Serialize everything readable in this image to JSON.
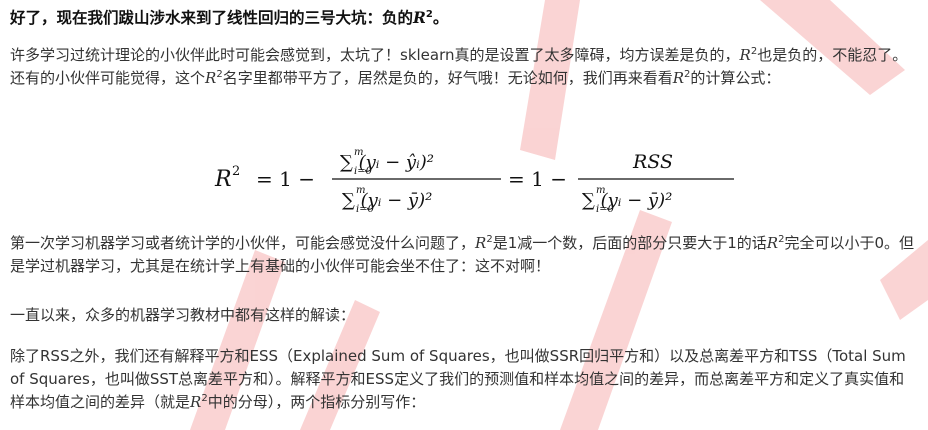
{
  "heading": {
    "text": "好了，现在我们跋山涉水来到了线性回归的三号大坑：负的",
    "symbol": "R",
    "sup": "2",
    "end": "。"
  },
  "p1": {
    "a": "许多学习过统计理论的小伙伴此时可能会感觉到，太坑了！sklearn真的是设置了太多障碍，均方误差是负的，",
    "r1": "R",
    "s1": "2",
    "b": "也",
    "c": "是负的，不能忍了。还有的小伙伴可能觉得，这个",
    "r2": "R",
    "s2": "2",
    "d": "名字里都带平方了，居然是负的，好气哦！无论如何，我们再",
    "e": "来看看",
    "r3": "R",
    "s3": "2",
    "f": "的计算公式："
  },
  "formula": {
    "lhs": "R",
    "lhs_sup": "2",
    "eq1": "= 1 −",
    "num1": "∑ (yᵢ − ŷᵢ)²",
    "den1": "∑ (yᵢ − ȳ)²",
    "sum_top": "m",
    "sum_bottom": "i=0",
    "eq2": "= 1 −",
    "num2": "RSS",
    "den2": "∑ (yᵢ − ȳ)²"
  },
  "p2": {
    "a": "第一次学习机器学习或者统计学的小伙伴，可能会感觉没什么问题了，",
    "r1": "R",
    "s1": "2",
    "b": "是1减一个数，后面的部分只要大于1的话",
    "r2": "R",
    "s2": "2",
    "c": "完全可以小于0。但是学过机器学习，尤其是在统计学上有基础的小伙伴可能会坐不住了：这不对啊！"
  },
  "p3": {
    "text": "一直以来，众多的机器学习教材中都有这样的解读："
  },
  "p4": {
    "a": "除了RSS之外，我们还有解释平方和ESS（Explained Sum of Squares，也叫做SSR回归平方和）以及总离差平方和",
    "b": "TSS（Total Sum of Squares，也叫做SST总离差平方和）。解释平方和ESS定义了我们的预测值和样本均值之间的差",
    "c": "异，而总离差平方和定义了真实值和样本均值之间的差异（就是",
    "r1": "R",
    "s1": "2",
    "d": "中的分母），两个指标分别写作："
  },
  "colors": {
    "text": "#333333",
    "heading": "#111111",
    "watermark": "#f4a3a3"
  }
}
